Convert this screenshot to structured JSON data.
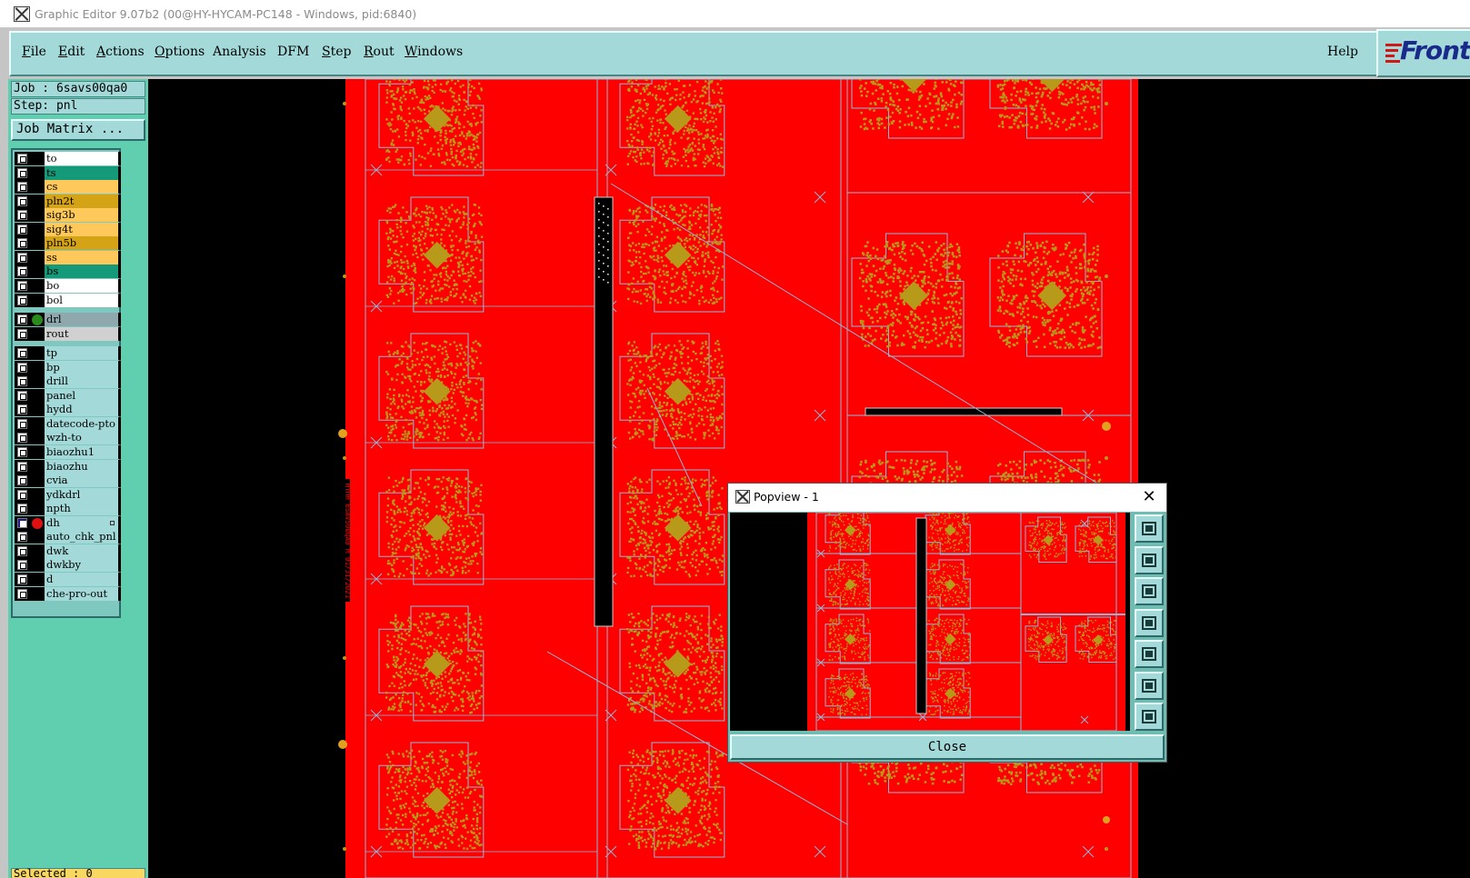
{
  "window": {
    "title": "Graphic Editor 9.07b2 (00@HY-HYCAM-PC148 - Windows, pid:6840)"
  },
  "menubar": {
    "items": [
      {
        "label": "File",
        "mnemonic": "F",
        "rest": "ile"
      },
      {
        "label": "Edit",
        "mnemonic": "E",
        "rest": "dit"
      },
      {
        "label": "Actions",
        "mnemonic": "A",
        "rest": "ctions"
      },
      {
        "label": "Options",
        "mnemonic": "O",
        "rest": "ptions"
      },
      {
        "label": "Analysis",
        "mnemonic": "",
        "rest": "Analysis"
      },
      {
        "label": "DFM",
        "mnemonic": "",
        "rest": "DFM"
      },
      {
        "label": "Step",
        "mnemonic": "S",
        "rest": "tep"
      },
      {
        "label": "Rout",
        "mnemonic": "R",
        "rest": "out"
      },
      {
        "label": "Windows",
        "mnemonic": "W",
        "rest": "indows"
      }
    ],
    "help": "Help",
    "logo": "Front"
  },
  "job": {
    "job_line": "Job : 6savs00qa0",
    "step_line": "Step: pnl",
    "matrix_button": "Job Matrix ..."
  },
  "layers": [
    {
      "name": "to",
      "color": "#ffffff",
      "checked": false,
      "dot": null
    },
    {
      "name": "ts",
      "color": "#149a78",
      "checked": false,
      "dot": null
    },
    {
      "name": "cs",
      "color": "#ffc85a",
      "checked": false,
      "dot": null
    },
    {
      "name": "pln2t",
      "color": "#d4a316",
      "checked": false,
      "dot": null
    },
    {
      "name": "sig3b",
      "color": "#ffc85a",
      "checked": false,
      "dot": null
    },
    {
      "name": "sig4t",
      "color": "#ffc85a",
      "checked": false,
      "dot": null
    },
    {
      "name": "pln5b",
      "color": "#d4a316",
      "checked": false,
      "dot": null
    },
    {
      "name": "ss",
      "color": "#ffc85a",
      "checked": false,
      "dot": null
    },
    {
      "name": "bs",
      "color": "#149a78",
      "checked": false,
      "dot": null
    },
    {
      "name": "bo",
      "color": "#ffffff",
      "checked": false,
      "dot": null
    },
    {
      "name": "bol",
      "color": "#ffffff",
      "checked": false,
      "dot": null
    },
    {
      "name": "drl",
      "color": "#8fa8ae",
      "checked": false,
      "dot": "#2a8a1a"
    },
    {
      "name": "rout",
      "color": "#d0d0d0",
      "checked": false,
      "dot": null
    },
    {
      "name": "tp",
      "color": "#a3d9d9",
      "checked": false,
      "dot": null
    },
    {
      "name": "bp",
      "color": "#a3d9d9",
      "checked": false,
      "dot": null
    },
    {
      "name": "drill",
      "color": "#a3d9d9",
      "checked": false,
      "dot": null
    },
    {
      "name": "panel",
      "color": "#a3d9d9",
      "checked": false,
      "dot": null
    },
    {
      "name": "hydd",
      "color": "#a3d9d9",
      "checked": false,
      "dot": null
    },
    {
      "name": "datecode-pto",
      "color": "#a3d9d9",
      "checked": false,
      "dot": null
    },
    {
      "name": "wzh-to",
      "color": "#a3d9d9",
      "checked": false,
      "dot": null
    },
    {
      "name": "biaozhu1",
      "color": "#a3d9d9",
      "checked": false,
      "dot": null
    },
    {
      "name": "biaozhu",
      "color": "#a3d9d9",
      "checked": false,
      "dot": null
    },
    {
      "name": "cvia",
      "color": "#a3d9d9",
      "checked": false,
      "dot": null
    },
    {
      "name": "ydkdrl",
      "color": "#a3d9d9",
      "checked": false,
      "dot": null
    },
    {
      "name": "npth",
      "color": "#a3d9d9",
      "checked": false,
      "dot": null
    },
    {
      "name": "dh",
      "color": "#a3d9d9",
      "checked": true,
      "dot": "#e01010"
    },
    {
      "name": "auto_chk_pnl",
      "color": "#a3d9d9",
      "checked": false,
      "dot": null
    },
    {
      "name": "dwk",
      "color": "#a3d9d9",
      "checked": false,
      "dot": null
    },
    {
      "name": "dwkby",
      "color": "#a3d9d9",
      "checked": false,
      "dot": null
    },
    {
      "name": "d",
      "color": "#a3d9d9",
      "checked": false,
      "dot": null
    },
    {
      "name": "che-pro-out",
      "color": "#a3d9d9",
      "checked": false,
      "dot": null
    }
  ],
  "status": {
    "selected": "Selected : 0"
  },
  "canvas": {
    "board_color": "#ff0000",
    "copper_color": "#b89a1a",
    "outline_color": "#8fb8d8",
    "side_text": "HYHH 6SAVS00QA0 M 01/31/2021"
  },
  "popview": {
    "title": "Popview - 1",
    "close_button": "Close",
    "tools": [
      "zoom-home-icon",
      "pan-up-icon",
      "pan-down-icon",
      "pan-left-icon",
      "pan-right-icon",
      "zoom-fit-icon",
      "zoom-center-icon"
    ]
  }
}
